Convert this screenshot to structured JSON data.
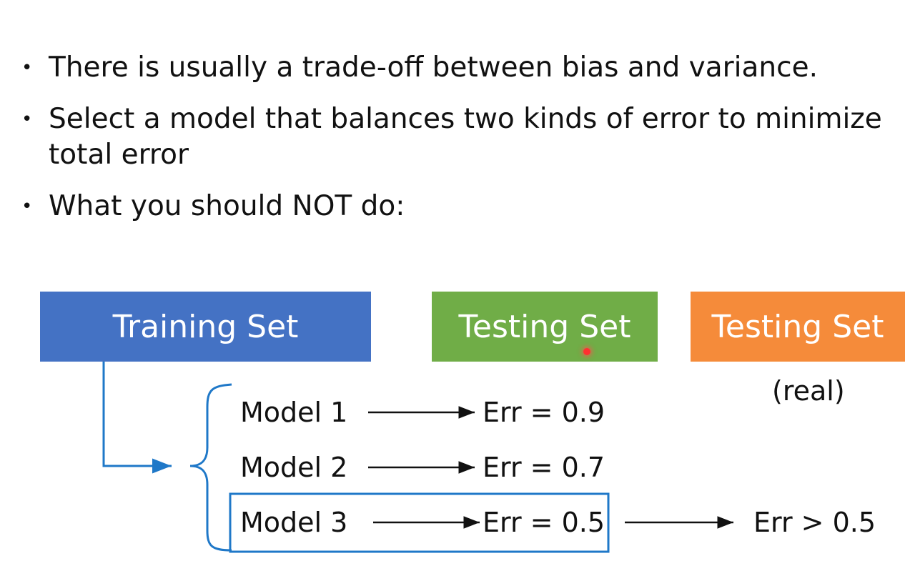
{
  "bullets": [
    "There is usually a trade-off between bias and variance.",
    "Select a model that balances two kinds of error to minimize total error",
    "What you should NOT do:"
  ],
  "boxes": {
    "training": "Training Set",
    "testing": "Testing Set",
    "testing_real": "Testing Set"
  },
  "real_note": "(real)",
  "models": [
    {
      "name": "Model 1",
      "err": "Err = 0.9"
    },
    {
      "name": "Model 2",
      "err": "Err = 0.7"
    },
    {
      "name": "Model 3",
      "err": "Err = 0.5"
    }
  ],
  "real_result": "Err > 0.5",
  "colors": {
    "training": "#4472c4",
    "testing": "#70ad47",
    "testing_real": "#f58b3a",
    "connector": "#1f78c8"
  }
}
